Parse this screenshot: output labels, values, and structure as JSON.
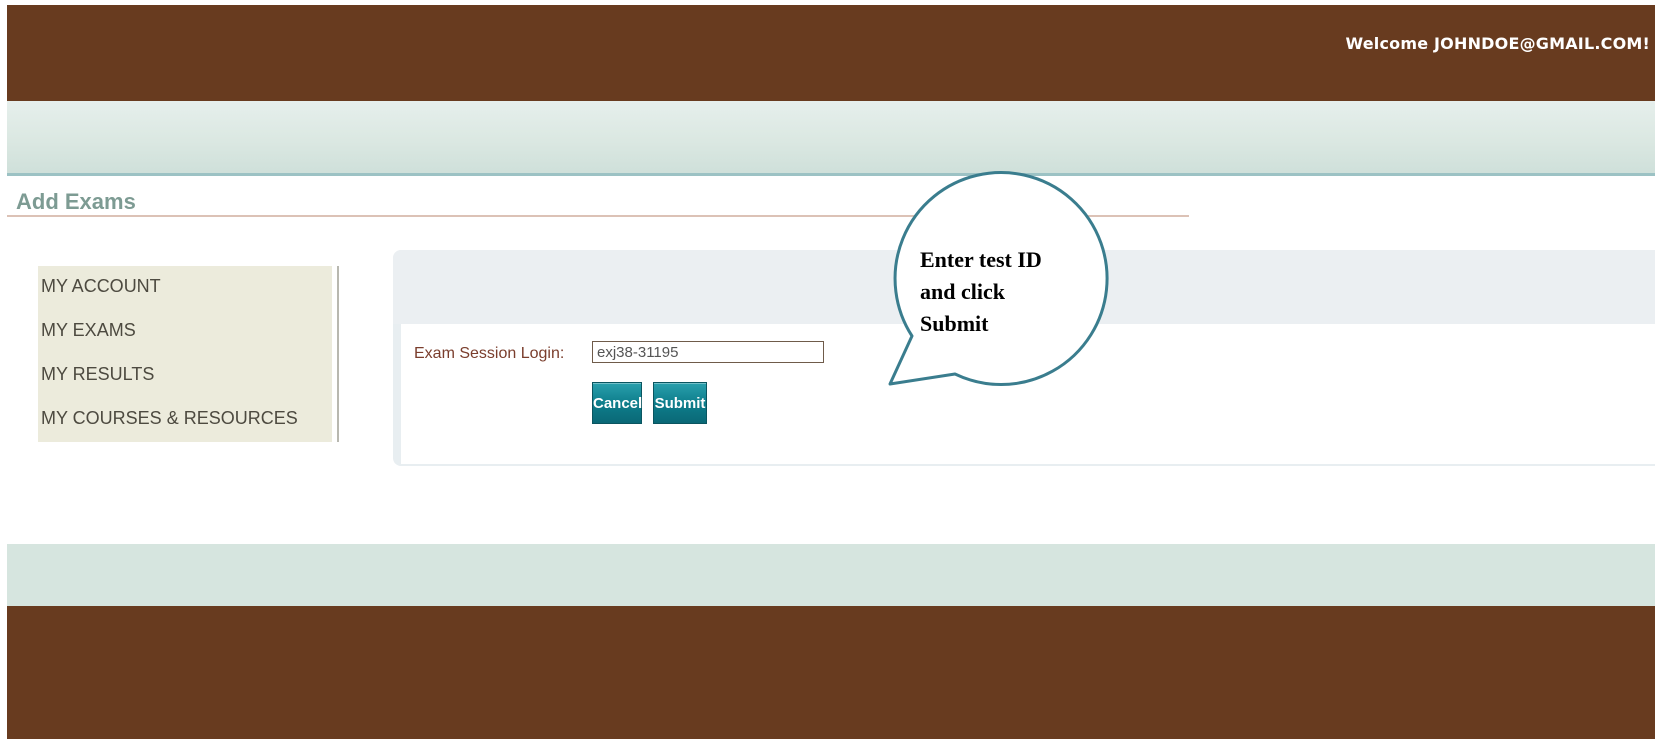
{
  "header": {
    "welcome_text": "Welcome JOHNDOE@GMAIL.COM!"
  },
  "page": {
    "title": "Add Exams"
  },
  "sidebar": {
    "items": [
      {
        "label": "MY ACCOUNT"
      },
      {
        "label": "MY EXAMS"
      },
      {
        "label": "MY RESULTS"
      },
      {
        "label": "MY COURSES & RESOURCES"
      }
    ]
  },
  "form": {
    "session_label": "Exam Session Login:",
    "session_value": "exj38-31195",
    "cancel_label": "Cancel",
    "submit_label": "Submit"
  },
  "callout": {
    "text": "Enter test ID and click Submit"
  },
  "colors": {
    "header_brown": "#683b1f",
    "accent_teal": "#0e7e8c",
    "title_green": "#7d9b93",
    "callout_border": "#3a7d8e"
  }
}
